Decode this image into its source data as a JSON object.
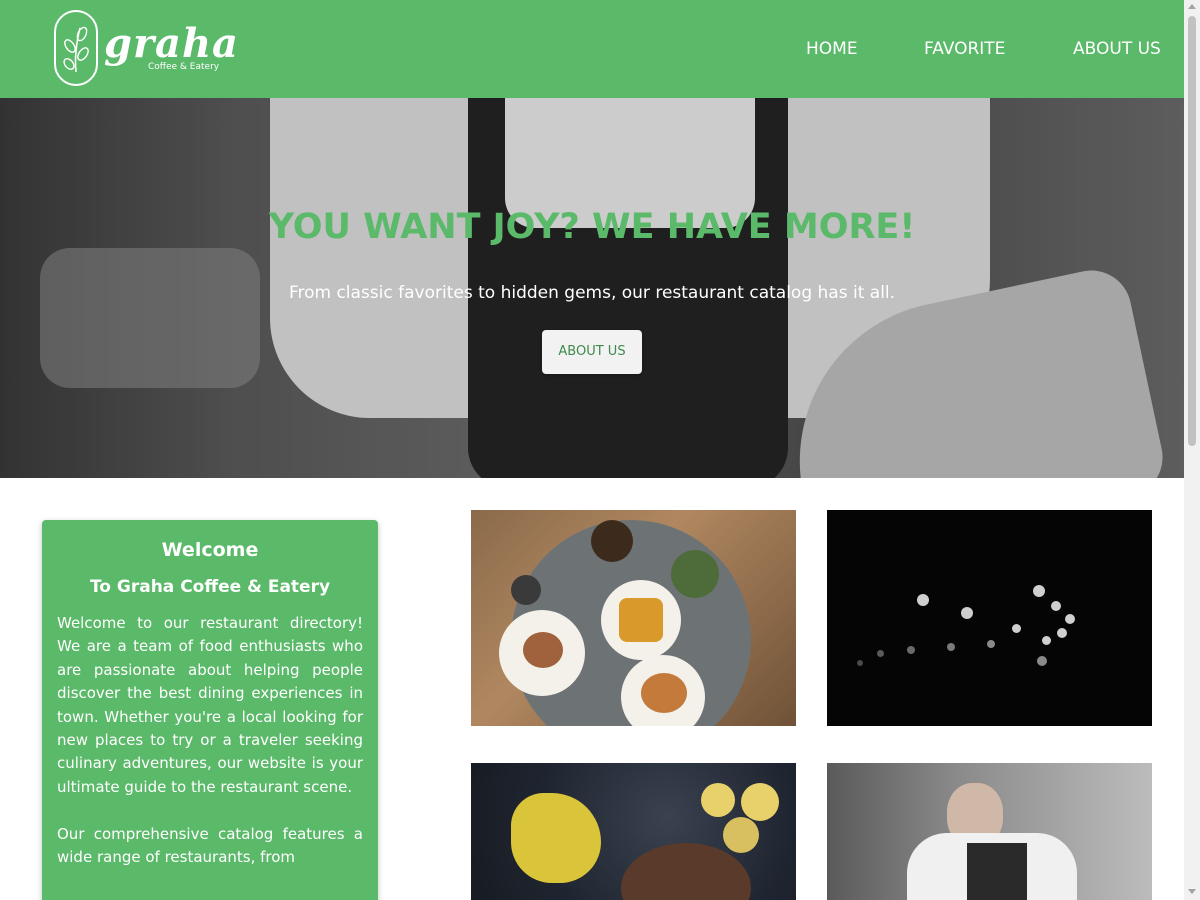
{
  "header": {
    "logo": {
      "name": "graha",
      "tagline": "Coffee & Eatery"
    },
    "nav": [
      {
        "label": "HOME"
      },
      {
        "label": "FAVORITE"
      },
      {
        "label": "ABOUT US"
      }
    ],
    "background_color": "#5bb96a"
  },
  "hero": {
    "title": "YOU WANT JOY? WE HAVE MORE!",
    "subtitle": "From classic favorites to hidden gems, our restaurant catalog has it all.",
    "button_label": "ABOUT US",
    "title_color": "#5bb96a"
  },
  "welcome": {
    "title": "Welcome",
    "subtitle": "To Graha Coffee & Eatery",
    "paragraphs": [
      "Welcome to our restaurant directory! We are a team of food enthusiasts who are passionate about helping people discover the best dining experiences in town. Whether you're a local looking for new places to try or a traveler seeking culinary adventures, our website is your ultimate guide to the restaurant scene.",
      "Our comprehensive catalog features a wide range of restaurants, from"
    ],
    "background_color": "#5bb96a"
  },
  "gallery": [
    {
      "icon": "food-table-photo"
    },
    {
      "icon": "bokeh-lights-photo"
    },
    {
      "icon": "flowers-food-photo"
    },
    {
      "icon": "chef-cooking-photo"
    }
  ]
}
